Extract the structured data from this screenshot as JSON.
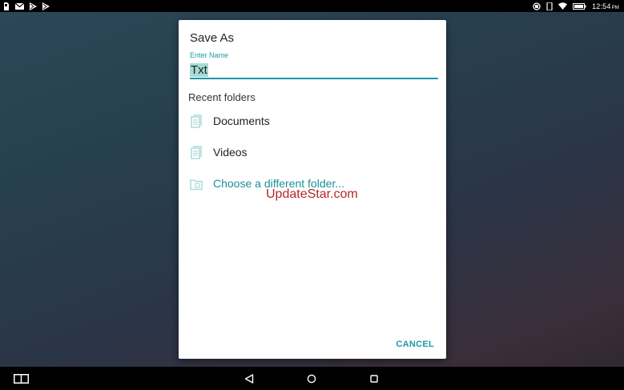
{
  "status_bar": {
    "left_icons": [
      "sd-card-icon",
      "mail-icon",
      "play-store-icon",
      "play-store-icon"
    ],
    "right_icons": [
      "sync-icon",
      "rotation-icon",
      "wifi-icon",
      "battery-icon"
    ],
    "time": "12:54",
    "ampm": "PM"
  },
  "dialog": {
    "title": "Save As",
    "field_label": "Enter Name",
    "name_value": "Txt",
    "section_label": "Recent folders",
    "folders": [
      {
        "label": "Documents",
        "icon": "document-icon"
      },
      {
        "label": "Videos",
        "icon": "document-icon"
      },
      {
        "label": "Choose a different folder...",
        "icon": "folder-browse-icon"
      }
    ],
    "cancel_label": "CANCEL"
  },
  "watermark": "UpdateStar.com",
  "colors": {
    "accent": "#199aa6",
    "selection": "#a5dcd3",
    "watermark": "#b3262a"
  },
  "nav_bar": {
    "icons": [
      "multi-window-icon",
      "back-icon",
      "home-icon",
      "recents-icon"
    ]
  }
}
